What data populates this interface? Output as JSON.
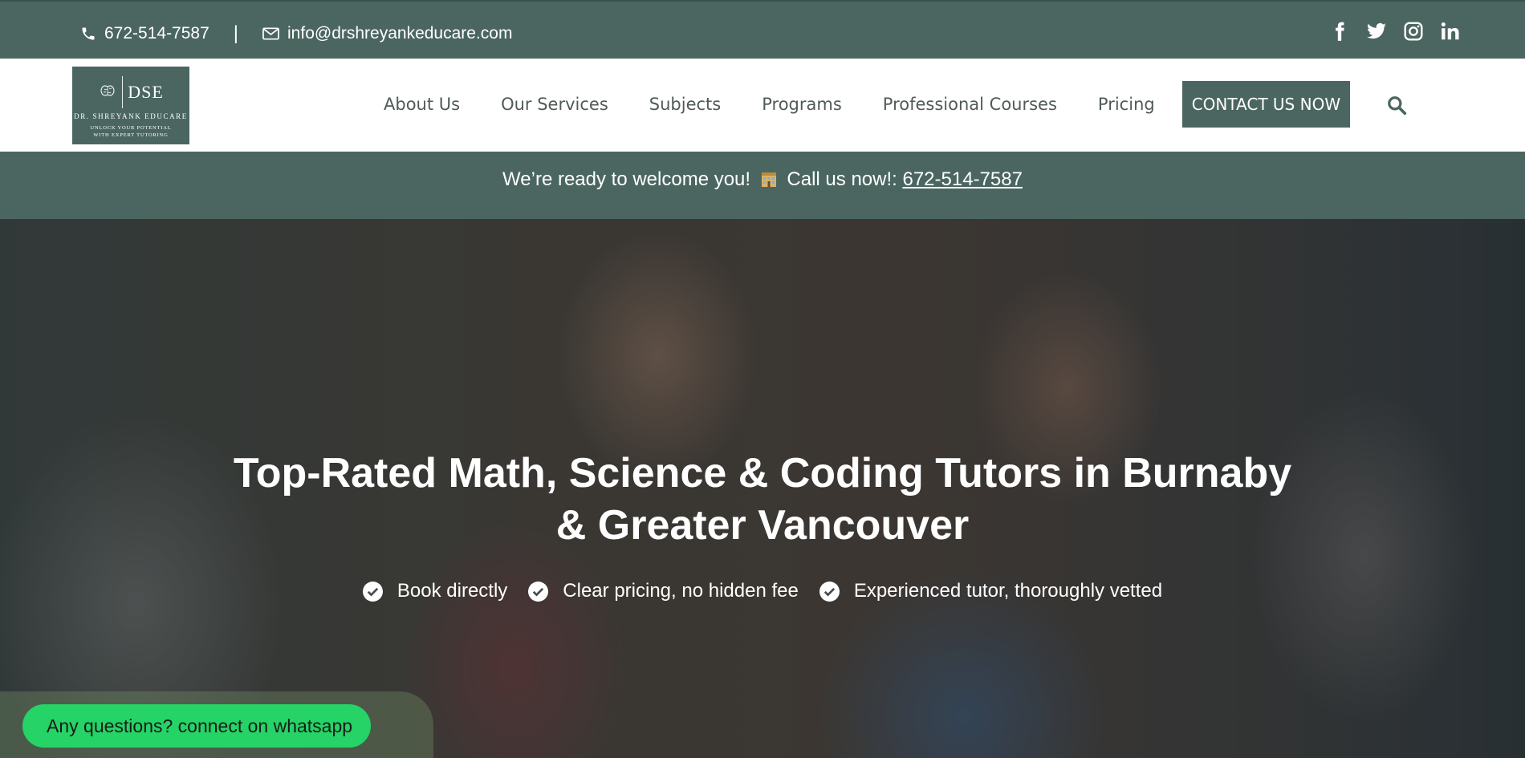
{
  "topbar": {
    "phone": "672-514-7587",
    "separator": "|",
    "email": "info@drshreyankeducare.com",
    "socials": [
      "facebook-icon",
      "twitter-icon",
      "instagram-icon",
      "linkedin-icon"
    ]
  },
  "logo": {
    "mark": "DSE",
    "name": "DR. SHREYANK EDUCARE",
    "tagline_1": "UNLOCK YOUR POTENTIAL",
    "tagline_2": "WITH EXPERT TUTORING"
  },
  "nav": {
    "items": [
      "About Us",
      "Our Services",
      "Subjects",
      "Programs",
      "Professional Courses",
      "Pricing"
    ],
    "cta": "CONTACT US NOW"
  },
  "announcement": {
    "text_before": "We’re ready to welcome you!",
    "text_after": "Call us now!:",
    "phone": "672-514-7587"
  },
  "hero": {
    "title_line1": "Top-Rated Math, Science & Coding Tutors in Burnaby",
    "title_line2": "& Greater Vancouver",
    "checks": [
      "Book directly",
      "Clear pricing, no hidden fee",
      "Experienced tutor, thoroughly vetted"
    ]
  },
  "whatsapp": {
    "label": "Any questions? connect on whatsapp"
  },
  "colors": {
    "brand": "#4b6660",
    "whatsapp": "#25d366",
    "nav_text": "#4f5b58"
  }
}
